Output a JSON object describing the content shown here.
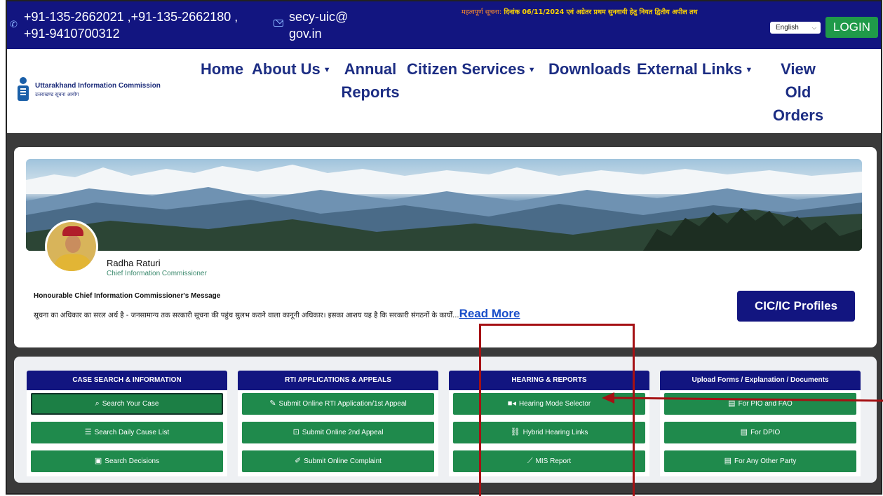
{
  "topbar": {
    "phone": "+91-135-2662021 ,+91-135-2662180 , +91-9410700312",
    "email": "secy-uic@gov.in",
    "notice_label": "महत्वपूर्ण सूचना:",
    "notice_text": "दिनांक 06/11/2024 एवं अग्रेतर प्रथम सुनवायी हेतु नियत द्वितीय अपील तथ",
    "language": "English",
    "login_label": "LOGIN"
  },
  "brand": {
    "name_en": "Uttarakhand Information Commission",
    "name_hi": "उत्तराखण्ड सूचना आयोग"
  },
  "nav": {
    "home": "Home",
    "about": "About Us",
    "annual1": "Annual",
    "annual2": "Reports",
    "citizen": "Citizen Services",
    "downloads": "Downloads",
    "external": "External Links",
    "view1": "View",
    "view2": "Old",
    "view3": "Orders"
  },
  "commissioner": {
    "name": "Radha Raturi",
    "title": "Chief Information Commissioner",
    "message_heading": "Honourable Chief Information Commissioner's Message",
    "message_text": "सूचना का अधिकार का सरल अर्थ है - जनसामान्य तक सरकारी सूचना की पहुंच सुलभ कराने वाला कानूनी अधिकार। इसका आशय यह है कि सरकारी संगठनों के कार्यों...",
    "read_more": "Read More",
    "profiles_button": "CIC/IC Profiles"
  },
  "panels": {
    "case": {
      "title": "CASE SEARCH & INFORMATION",
      "b1": "Search Your Case",
      "b2": "Search Daily Cause List",
      "b3": "Search Decisions"
    },
    "rti": {
      "title": "RTI APPLICATIONS & APPEALS",
      "b1": "Submit Online RTI Application/1st Appeal",
      "b2": "Submit Online 2nd Appeal",
      "b3": "Submit Online Complaint"
    },
    "hearing": {
      "title": "HEARING & REPORTS",
      "b1": "Hearing Mode Selector",
      "b2": "Hybrid Hearing Links",
      "b3": "MIS Report"
    },
    "upload": {
      "title": "Upload Forms / Explanation / Documents",
      "b1": "For PIO and FAO",
      "b2": "For DPIO",
      "b3": "For Any Other Party"
    }
  },
  "colors": {
    "navy": "#121580",
    "green": "#1f8a4c",
    "login_green": "#1f9a49",
    "annotation_red": "#a51114"
  }
}
